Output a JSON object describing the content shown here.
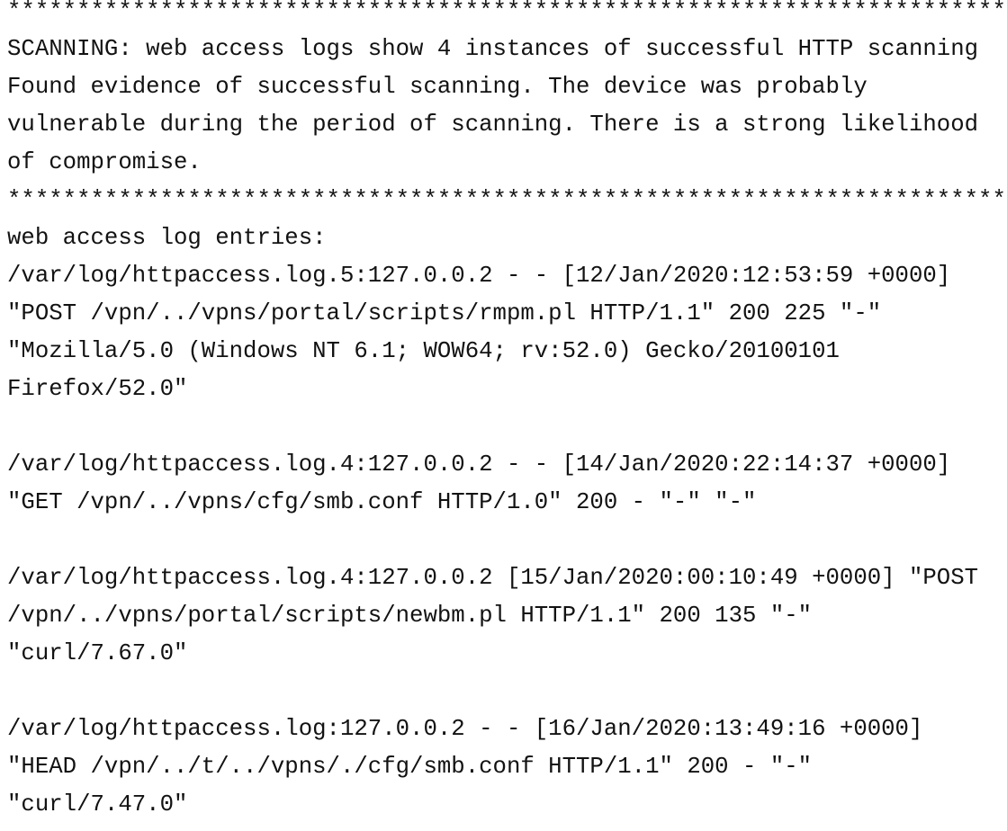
{
  "report": {
    "separator_top": "************************************************************************",
    "separator_bottom": "************************************************************************",
    "summary": {
      "heading": "SCANNING: web access logs show 4 instances of successful HTTP scanning",
      "body_line_1": "Found evidence of successful scanning. The device was probably",
      "body_line_2": "vulnerable during the period of scanning. There is a strong likelihood",
      "body_line_3": "of compromise."
    },
    "logs_heading": "web access log entries:",
    "entries": [
      {
        "line_1": "/var/log/httpaccess.log.5:127.0.0.2 - - [12/Jan/2020:12:53:59 +0000]",
        "line_2": "\"POST /vpn/../vpns/portal/scripts/rmpm.pl HTTP/1.1\" 200 225 \"-\"",
        "line_3": "\"Mozilla/5.0 (Windows NT 6.1; WOW64; rv:52.0) Gecko/20100101",
        "line_4": "Firefox/52.0\""
      },
      {
        "line_1": "/var/log/httpaccess.log.4:127.0.0.2 - - [14/Jan/2020:22:14:37 +0000]",
        "line_2": "\"GET /vpn/../vpns/cfg/smb.conf HTTP/1.0\" 200 - \"-\" \"-\"",
        "line_3": "",
        "line_4": ""
      },
      {
        "line_1": "/var/log/httpaccess.log.4:127.0.0.2 [15/Jan/2020:00:10:49 +0000] \"POST",
        "line_2": "/vpn/../vpns/portal/scripts/newbm.pl HTTP/1.1\" 200 135 \"-\"",
        "line_3": "\"curl/7.67.0\"",
        "line_4": ""
      },
      {
        "line_1": "/var/log/httpaccess.log:127.0.0.2 - - [16/Jan/2020:13:49:16 +0000]",
        "line_2": "\"HEAD /vpn/../t/../vpns/./cfg/smb.conf HTTP/1.1\" 200 - \"-\"",
        "line_3": "\"curl/7.47.0\"",
        "line_4": ""
      }
    ]
  }
}
